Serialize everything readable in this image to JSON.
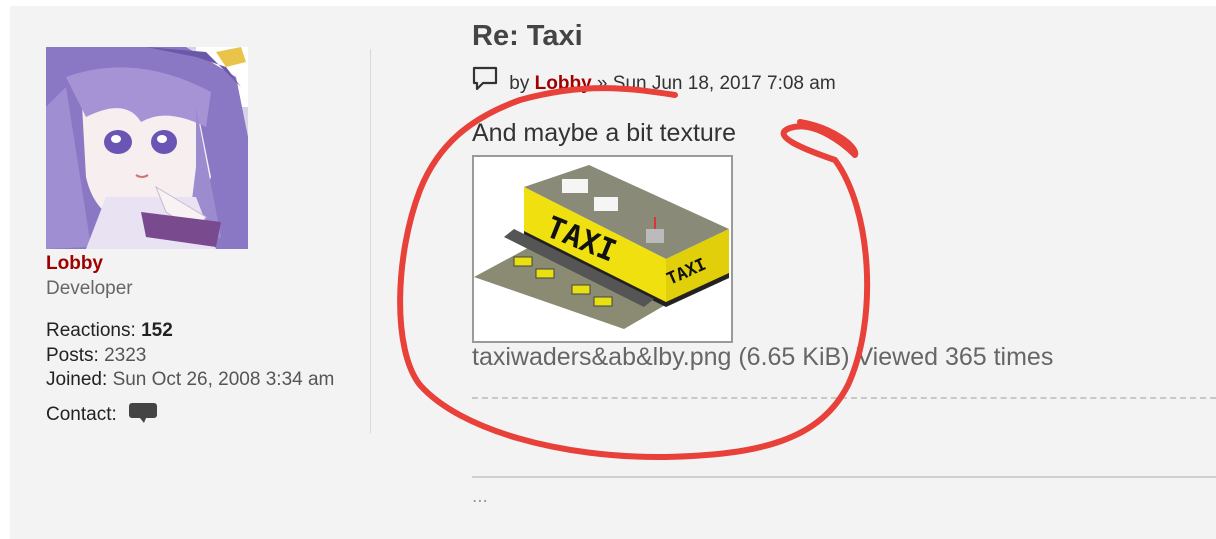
{
  "profile": {
    "username": "Lobby",
    "rank": "Developer",
    "reactions_label": "Reactions:",
    "reactions_value": "152",
    "posts_label": "Posts:",
    "posts_value": "2323",
    "joined_label": "Joined:",
    "joined_value": "Sun Oct 26, 2008 3:34 am",
    "contact_label": "Contact:"
  },
  "post": {
    "title": "Re: Taxi",
    "by_label": "by",
    "author": "Lobby",
    "date_text": "» Sun Jun 18, 2017 7:08 am",
    "body_text": "And maybe a bit texture",
    "attachment_caption": "taxiwaders&ab&lby.png (6.65 KiB) Viewed 365 times",
    "ellipsis": "...",
    "attachment_image": {
      "sign_text_front": "TAXI",
      "sign_text_side": "TAXI"
    }
  },
  "colors": {
    "author_red": "#a00000",
    "annotation_red": "#e8413a",
    "background": "#f3f3f3"
  },
  "icons": {
    "post_icon": "speech-bubble-outline-icon",
    "contact_icon": "chat-bubble-filled-icon"
  }
}
